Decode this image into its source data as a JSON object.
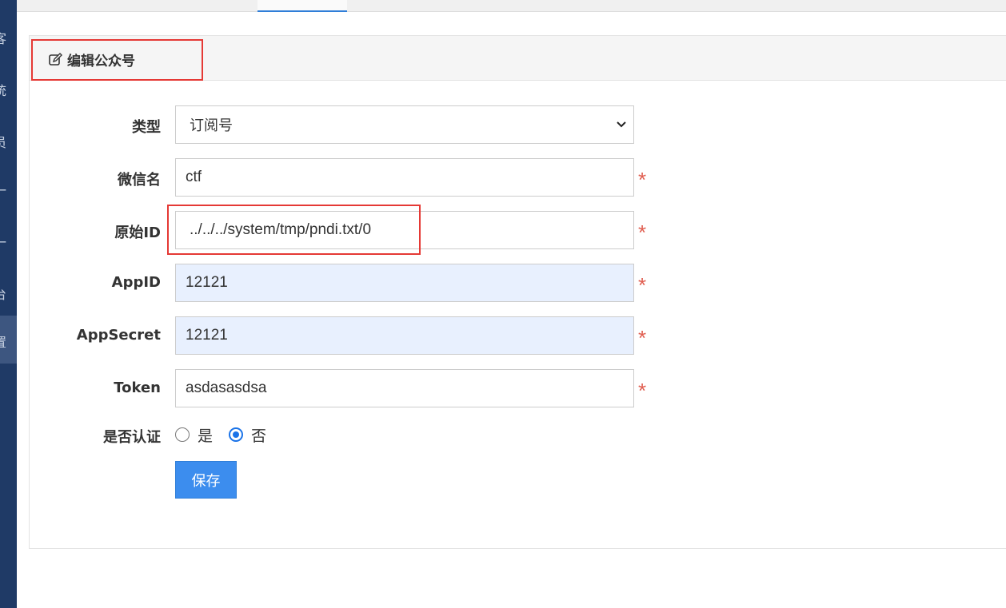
{
  "sidebar": {
    "items": [
      {
        "char": "客",
        "active": false
      },
      {
        "char": "统",
        "active": false
      },
      {
        "char": "员",
        "active": false
      },
      {
        "char": "一",
        "active": false
      },
      {
        "char": "一",
        "active": false
      },
      {
        "char": "台",
        "active": false
      },
      {
        "char": "置",
        "active": true
      }
    ]
  },
  "panel": {
    "title": "编辑公众号"
  },
  "form": {
    "type_label": "类型",
    "type_value": "订阅号",
    "wechat_name_label": "微信名",
    "wechat_name_value": "ctf",
    "original_id_label": "原始ID",
    "original_id_value": "../../../system/tmp/pndi.txt/0",
    "appid_label": "AppID",
    "appid_value": "12121",
    "appsecret_label": "AppSecret",
    "appsecret_value": "12121",
    "token_label": "Token",
    "token_value": "asdasasdsa",
    "required_mark": "*",
    "verified_label": "是否认证",
    "verified_yes": "是",
    "verified_no": "否",
    "verified_selected": "否",
    "save_label": "保存"
  },
  "colors": {
    "sidebar": "#1f3a66",
    "primary": "#3c8dee",
    "required": "#e05d4f",
    "highlight": "#e53935",
    "autofill": "#e8f0fe"
  }
}
